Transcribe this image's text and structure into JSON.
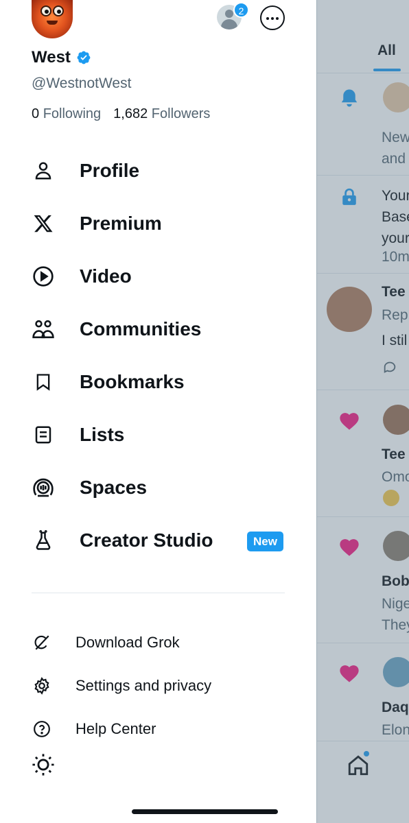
{
  "profile": {
    "name": "West",
    "handle": "@WestnotWest",
    "following_count": "0",
    "following_label": "Following",
    "followers_count": "1,682",
    "followers_label": "Followers",
    "account_badge_count": "2"
  },
  "menu": {
    "items": [
      {
        "label": "Profile",
        "icon": "person-icon"
      },
      {
        "label": "Premium",
        "icon": "x-logo-icon"
      },
      {
        "label": "Video",
        "icon": "play-circle-icon"
      },
      {
        "label": "Communities",
        "icon": "communities-icon"
      },
      {
        "label": "Bookmarks",
        "icon": "bookmark-icon"
      },
      {
        "label": "Lists",
        "icon": "list-icon"
      },
      {
        "label": "Spaces",
        "icon": "spaces-icon"
      },
      {
        "label": "Creator Studio",
        "icon": "flask-icon",
        "badge": "New"
      }
    ]
  },
  "secondary_menu": {
    "items": [
      {
        "label": "Download Grok",
        "icon": "grok-icon"
      },
      {
        "label": "Settings and privacy",
        "icon": "gear-icon"
      },
      {
        "label": "Help Center",
        "icon": "help-icon"
      }
    ],
    "theme_icon": "sun-icon"
  },
  "background_panel": {
    "tab_all": "All",
    "lines": [
      "New",
      "and",
      "Your",
      "Base",
      "your",
      "10m",
      "Tee",
      "Rep",
      "I stil",
      "Tee",
      "Omo",
      "Bob",
      "Nige",
      "They",
      "Daq",
      "Elon"
    ]
  },
  "colors": {
    "accent": "#1d9bf0",
    "text_primary": "#0f1419",
    "text_secondary": "#536471",
    "heart": "#f91880",
    "overlay": "rgba(91,112,131,0.4)"
  }
}
